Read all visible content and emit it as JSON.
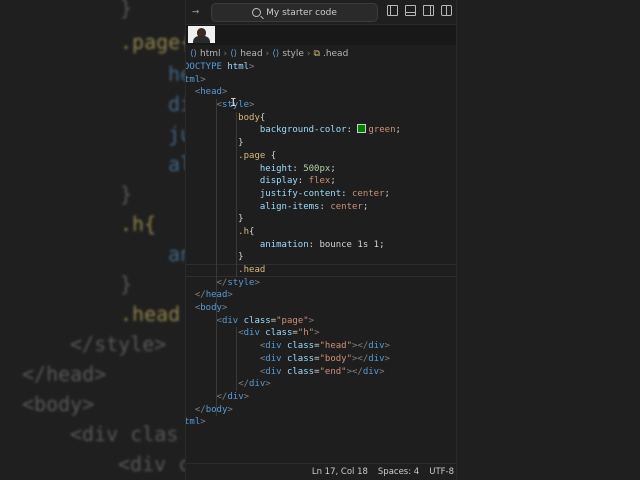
{
  "background_code": [
    "}",
    ".page{",
    "he",
    "di",
    "ju",
    "al",
    "}",
    ".h{",
    "an",
    "}",
    ".head",
    "</style>",
    "</head>",
    "<body>",
    "<div clas",
    "<div c"
  ],
  "titlebar": {
    "search_label": "My starter code"
  },
  "breadcrumb": [
    "html",
    "head",
    "style",
    ".head"
  ],
  "code_lines": [
    [
      [
        "DOCTYPE ",
        "k-tag"
      ],
      [
        "html",
        "k-attr"
      ],
      [
        ">",
        "k-punc"
      ]
    ],
    [
      [
        "tml",
        "k-tag"
      ],
      [
        ">",
        "k-punc"
      ]
    ],
    [
      [
        "  ",
        ""
      ],
      [
        "<",
        "k-punc"
      ],
      [
        "head",
        "k-tag"
      ],
      [
        ">",
        "k-punc"
      ]
    ],
    [
      [
        "      ",
        ""
      ],
      [
        "<",
        "k-punc"
      ],
      [
        "style",
        "k-tag"
      ],
      [
        ">",
        "k-punc"
      ]
    ],
    [
      [
        "          body",
        "k-sel"
      ],
      [
        "{",
        "k-plain"
      ]
    ],
    [
      [
        "              background-color",
        "k-prop"
      ],
      [
        ": ",
        "k-plain"
      ],
      [
        "SWATCH",
        "swatch"
      ],
      [
        "green",
        "k-val"
      ],
      [
        ";",
        "k-plain"
      ]
    ],
    [
      [
        "          }",
        "k-plain"
      ]
    ],
    [
      [
        "          .page ",
        "k-sel"
      ],
      [
        "{",
        "k-plain"
      ]
    ],
    [
      [
        "              height",
        "k-prop"
      ],
      [
        ": ",
        "k-plain"
      ],
      [
        "500px",
        "k-num"
      ],
      [
        ";",
        "k-plain"
      ]
    ],
    [
      [
        "              display",
        "k-prop"
      ],
      [
        ": ",
        "k-plain"
      ],
      [
        "flex",
        "k-val"
      ],
      [
        ";",
        "k-plain"
      ]
    ],
    [
      [
        "              justify-content",
        "k-prop"
      ],
      [
        ": ",
        "k-plain"
      ],
      [
        "center",
        "k-val"
      ],
      [
        ";",
        "k-plain"
      ]
    ],
    [
      [
        "              align-items",
        "k-prop"
      ],
      [
        ": ",
        "k-plain"
      ],
      [
        "center",
        "k-val"
      ],
      [
        ";",
        "k-plain"
      ]
    ],
    [
      [
        "          }",
        "k-plain"
      ]
    ],
    [
      [
        "          .h",
        "k-sel"
      ],
      [
        "{",
        "k-plain"
      ]
    ],
    [
      [
        "              animation",
        "k-prop"
      ],
      [
        ": ",
        "k-plain"
      ],
      [
        "bounce 1s 1",
        "k-plain"
      ],
      [
        ";",
        "k-plain"
      ]
    ],
    [
      [
        "          }",
        "k-plain"
      ]
    ],
    [
      [
        "          .head",
        "k-sel"
      ]
    ],
    [
      [
        "      ",
        ""
      ],
      [
        "</",
        "k-punc"
      ],
      [
        "style",
        "k-tag"
      ],
      [
        ">",
        "k-punc"
      ]
    ],
    [
      [
        "  ",
        ""
      ],
      [
        "</",
        "k-punc"
      ],
      [
        "head",
        "k-tag"
      ],
      [
        ">",
        "k-punc"
      ]
    ],
    [
      [
        "  ",
        ""
      ],
      [
        "<",
        "k-punc"
      ],
      [
        "body",
        "k-tag"
      ],
      [
        ">",
        "k-punc"
      ]
    ],
    [
      [
        "      ",
        ""
      ],
      [
        "<",
        "k-punc"
      ],
      [
        "div ",
        "k-tag"
      ],
      [
        "class",
        "k-attr"
      ],
      [
        "=",
        "k-plain"
      ],
      [
        "\"page\"",
        "k-str"
      ],
      [
        ">",
        "k-punc"
      ]
    ],
    [
      [
        "          ",
        ""
      ],
      [
        "<",
        "k-punc"
      ],
      [
        "div ",
        "k-tag"
      ],
      [
        "class",
        "k-attr"
      ],
      [
        "=",
        "k-plain"
      ],
      [
        "\"h\"",
        "k-str"
      ],
      [
        ">",
        "k-punc"
      ]
    ],
    [
      [
        "              ",
        ""
      ],
      [
        "<",
        "k-punc"
      ],
      [
        "div ",
        "k-tag"
      ],
      [
        "class",
        "k-attr"
      ],
      [
        "=",
        "k-plain"
      ],
      [
        "\"head\"",
        "k-str"
      ],
      [
        "></",
        "k-punc"
      ],
      [
        "div",
        "k-tag"
      ],
      [
        ">",
        "k-punc"
      ]
    ],
    [
      [
        "              ",
        ""
      ],
      [
        "<",
        "k-punc"
      ],
      [
        "div ",
        "k-tag"
      ],
      [
        "class",
        "k-attr"
      ],
      [
        "=",
        "k-plain"
      ],
      [
        "\"body\"",
        "k-str"
      ],
      [
        "></",
        "k-punc"
      ],
      [
        "div",
        "k-tag"
      ],
      [
        ">",
        "k-punc"
      ]
    ],
    [
      [
        "              ",
        ""
      ],
      [
        "<",
        "k-punc"
      ],
      [
        "div ",
        "k-tag"
      ],
      [
        "class",
        "k-attr"
      ],
      [
        "=",
        "k-plain"
      ],
      [
        "\"end\"",
        "k-str"
      ],
      [
        "></",
        "k-punc"
      ],
      [
        "div",
        "k-tag"
      ],
      [
        ">",
        "k-punc"
      ]
    ],
    [
      [
        "          ",
        ""
      ],
      [
        "</",
        "k-punc"
      ],
      [
        "div",
        "k-tag"
      ],
      [
        ">",
        "k-punc"
      ]
    ],
    [
      [
        "      ",
        ""
      ],
      [
        "</",
        "k-punc"
      ],
      [
        "div",
        "k-tag"
      ],
      [
        ">",
        "k-punc"
      ]
    ],
    [
      [
        "  ",
        ""
      ],
      [
        "</",
        "k-punc"
      ],
      [
        "body",
        "k-tag"
      ],
      [
        ">",
        "k-punc"
      ]
    ],
    [
      [
        "tml",
        "k-tag"
      ],
      [
        ">",
        "k-punc"
      ]
    ]
  ],
  "current_line_index": 16,
  "status": {
    "position": "Ln 17, Col 18",
    "spaces": "Spaces: 4",
    "encoding": "UTF-8"
  }
}
